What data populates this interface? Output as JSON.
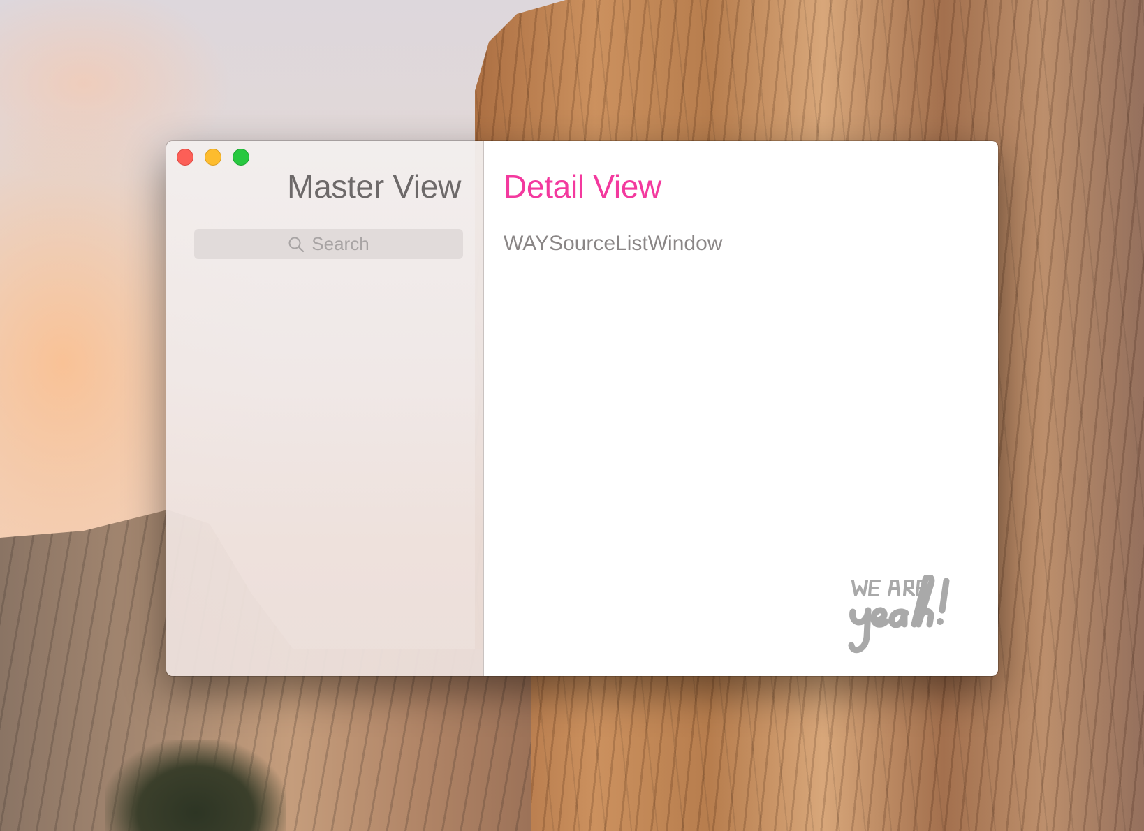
{
  "window": {
    "master": {
      "title": "Master View",
      "search": {
        "placeholder": "Search"
      }
    },
    "detail": {
      "title": "Detail View",
      "body_text": "WAYSourceListWindow"
    },
    "traffic_lights": [
      {
        "name": "close",
        "color": "#fc5f57"
      },
      {
        "name": "minimize",
        "color": "#fdbc2e"
      },
      {
        "name": "zoom",
        "color": "#28c840"
      }
    ],
    "logo": {
      "line1": "WE ARE",
      "line2": "yeah!"
    }
  },
  "colors": {
    "accent": "#f3399e",
    "master_title": "#6d6969",
    "detail_text": "#8a8686"
  }
}
